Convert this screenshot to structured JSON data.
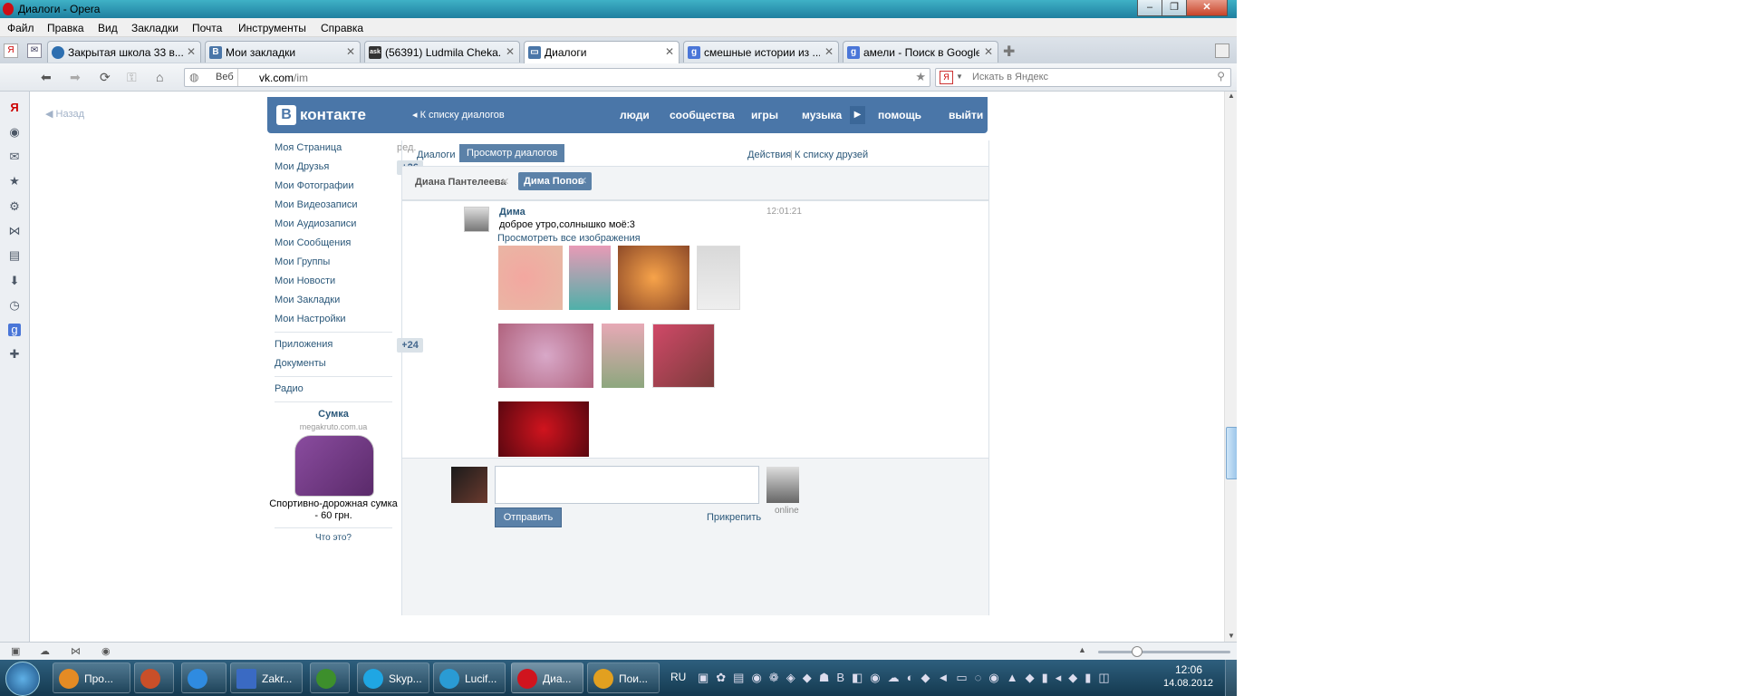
{
  "window": {
    "title": "Диалоги - Opera"
  },
  "menu": [
    "Файл",
    "Правка",
    "Вид",
    "Закладки",
    "Почта",
    "Инструменты",
    "Справка"
  ],
  "tabs": [
    {
      "label": "Закрытая школа 33 в...",
      "icon": "tab-icon",
      "color": "#2d6fb0"
    },
    {
      "label": "Мои закладки",
      "icon": "vk-icon",
      "color": "#4a76a8"
    },
    {
      "label": "(56391) Ludmila Cheka...",
      "icon": "ask-icon",
      "color": "#333333"
    },
    {
      "label": "Диалоги",
      "icon": "vk-icon",
      "color": "#4a76a8"
    },
    {
      "label": "смешные истории из ...",
      "icon": "google-icon",
      "color": "#4a76d8"
    },
    {
      "label": "амели - Поиск в Google",
      "icon": "google-icon",
      "color": "#4a76d8"
    }
  ],
  "address": {
    "scheme_label": "Веб",
    "url_host": "vk.com",
    "url_path": "/im",
    "search_placeholder": "Искать в Яндекс"
  },
  "vk": {
    "back": "Назад",
    "logo": "контакте",
    "to_list": "К списку диалогов",
    "nav": [
      "люди",
      "сообщества",
      "игры",
      "музыка",
      "помощь",
      "выйти"
    ],
    "left_menu": [
      {
        "label": "Моя Страница",
        "extra": "ред."
      },
      {
        "label": "Мои Друзья",
        "badge": "+26"
      },
      {
        "label": "Мои Фотографии"
      },
      {
        "label": "Мои Видеозаписи"
      },
      {
        "label": "Мои Аудиозаписи"
      },
      {
        "label": "Мои Сообщения"
      },
      {
        "label": "Мои Группы"
      },
      {
        "label": "Мои Новости"
      },
      {
        "label": "Мои Закладки"
      },
      {
        "label": "Мои Настройки"
      }
    ],
    "apps": {
      "label": "Приложения",
      "badge": "+24"
    },
    "docs": "Документы",
    "radio": "Радио",
    "ad": {
      "title": "Сумка",
      "domain": "megakruto.com.ua",
      "text": "Спортивно-дорожная сумка - 60 грн.",
      "what": "Что это?"
    },
    "tabs": [
      "Диалоги",
      "Просмотр диалогов"
    ],
    "actions": "Действия",
    "friends_link": "К списку друзей",
    "dialogs": [
      "Диана Пантелеева",
      "Дима Попов"
    ],
    "message": {
      "author": "Дима",
      "time": "12:01:21",
      "text": "доброе утро,солнышко моё:3",
      "view_all": "Просмотреть все изображения"
    },
    "send": "Отправить",
    "attach": "Прикрепить",
    "online": "online"
  },
  "taskbar": {
    "items": [
      "Про...",
      "",
      "",
      "Zakr...",
      "",
      "Skyp...",
      "Lucif...",
      "Диа...",
      "Пои..."
    ],
    "lang": "RU",
    "time": "12:06",
    "date": "14.08.2012"
  }
}
